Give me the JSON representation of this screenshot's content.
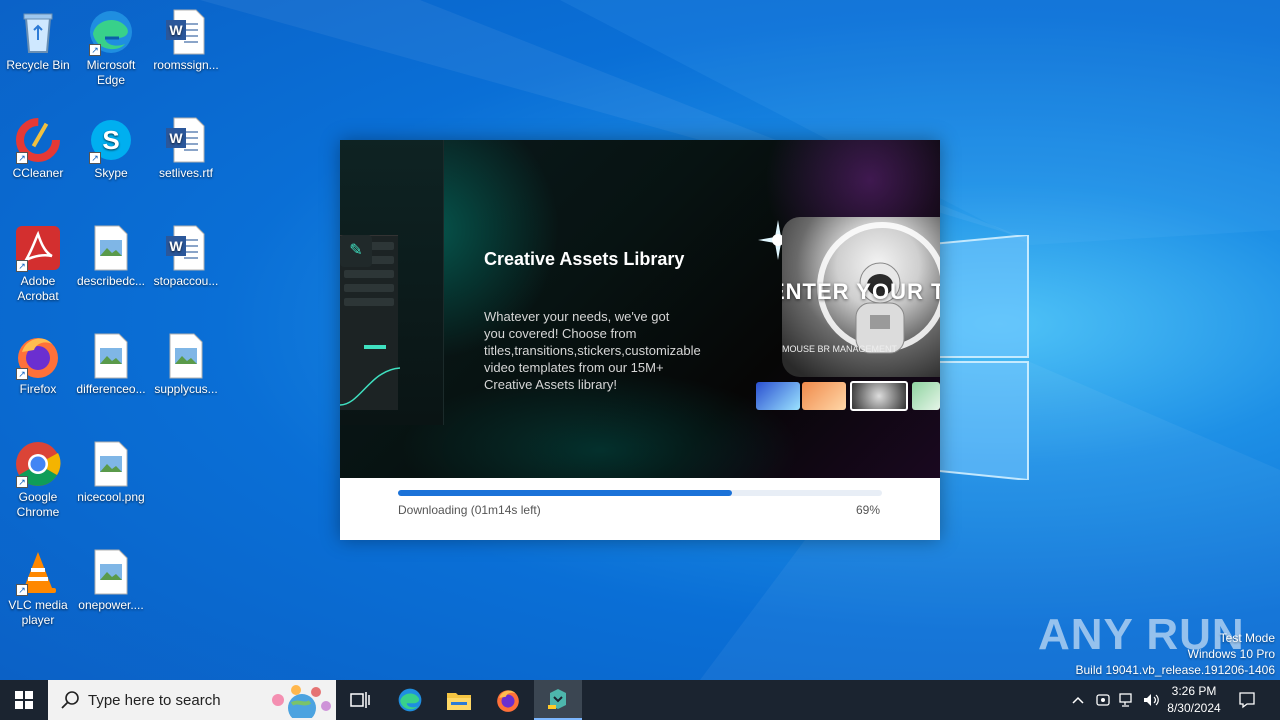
{
  "desktop": {
    "icons": [
      {
        "label": "Recycle Bin"
      },
      {
        "label": "Microsoft Edge"
      },
      {
        "label": "roomssign..."
      },
      {
        "label": "CCleaner"
      },
      {
        "label": "Skype"
      },
      {
        "label": "setlives.rtf"
      },
      {
        "label": "Adobe Acrobat"
      },
      {
        "label": "describedc..."
      },
      {
        "label": "stopaccou..."
      },
      {
        "label": "Firefox"
      },
      {
        "label": "differenceo..."
      },
      {
        "label": "supplycus..."
      },
      {
        "label": "Google Chrome"
      },
      {
        "label": "nicecool.png"
      },
      {
        "label": "VLC media player"
      },
      {
        "label": "onepower...."
      }
    ]
  },
  "installer": {
    "banner_title": "Creative Assets Library",
    "banner_text": "Whatever your needs, we've got you covered! Choose from titles,transitions,stickers,customizable video templates from our 15M+ Creative Assets library!",
    "preview_heading": "ENTER YOUR T",
    "preview_sub": "MOUSE BR MANAGEMENT",
    "status": "Downloading (01m14s left)",
    "percent_label": "69%",
    "progress": 0.69,
    "accent": "#1b72d8"
  },
  "watermark": {
    "brand": "ANY RUN",
    "mode": "Test Mode",
    "edition": "Windows 10 Pro",
    "build": "Build 19041.vb_release.191206-1406"
  },
  "taskbar": {
    "search_placeholder": "Type here to search",
    "time": "3:26 PM",
    "date": "8/30/2024",
    "apps": [
      "task-view",
      "edge",
      "file-explorer",
      "firefox",
      "installer"
    ]
  }
}
